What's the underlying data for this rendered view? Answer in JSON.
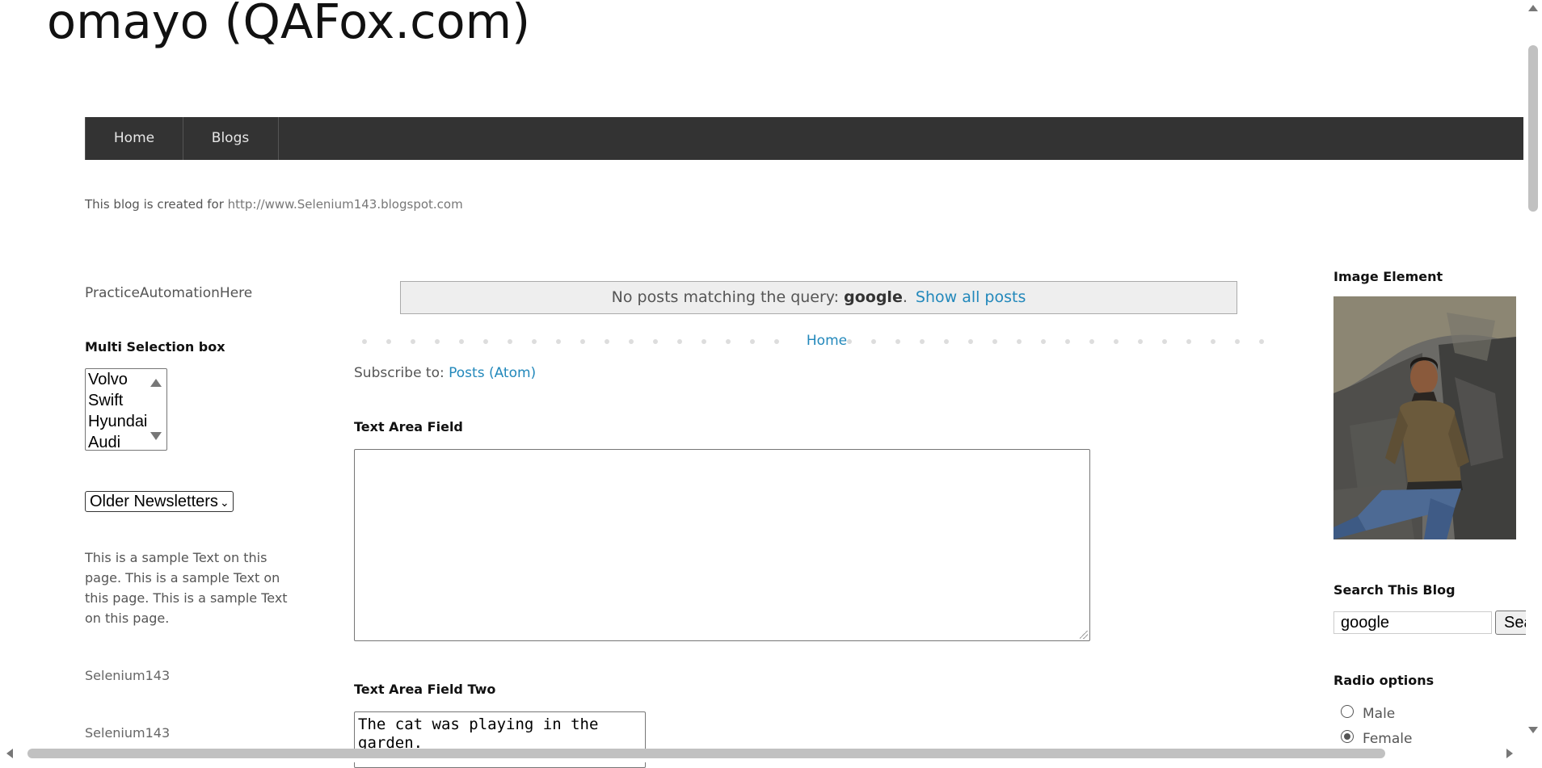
{
  "header": {
    "title": "omayo (QAFox.com)",
    "description_prefix": "This blog is created for ",
    "description_link": "http://www.Selenium143.blogspot.com"
  },
  "nav": {
    "items": [
      {
        "label": "Home"
      },
      {
        "label": "Blogs"
      }
    ]
  },
  "left_sidebar": {
    "title": "PracticeAutomationHere",
    "multi_select": {
      "heading": "Multi Selection box",
      "options": [
        "Volvo",
        "Swift",
        "Hyundai",
        "Audi"
      ]
    },
    "dropdown": {
      "selected": "Older Newsletters"
    },
    "sample_text": "This is a sample Text on this page. This is a sample Text on this page. This is a sample Text on this page.",
    "links": [
      "Selenium143",
      "Selenium143"
    ]
  },
  "main": {
    "status": {
      "prefix": "No posts matching the query: ",
      "query": "google",
      "suffix": ".",
      "show_all": "Show all posts"
    },
    "pager_home": "Home",
    "subscribe": {
      "prefix": "Subscribe to: ",
      "link": "Posts (Atom)"
    },
    "textarea_one": {
      "heading": "Text Area Field",
      "value": ""
    },
    "textarea_two": {
      "heading": "Text Area Field Two",
      "value": "The cat was playing in the garden."
    }
  },
  "right_sidebar": {
    "image_heading": "Image Element",
    "search": {
      "heading": "Search This Blog",
      "value": "google",
      "button": "Search"
    },
    "radio": {
      "heading": "Radio options",
      "options": [
        {
          "label": "Male",
          "checked": false
        },
        {
          "label": "Female",
          "checked": true
        }
      ]
    }
  },
  "colors": {
    "nav_bg": "#333333",
    "link": "#2288bb",
    "status_bg": "#eeeeee"
  }
}
